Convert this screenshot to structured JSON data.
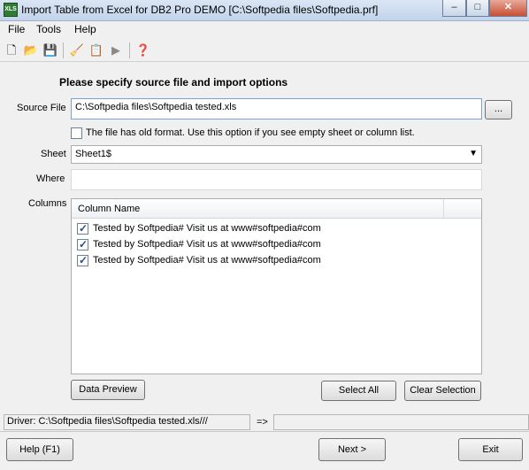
{
  "window": {
    "title": "Import Table from Excel for DB2 Pro DEMO [C:\\Softpedia files\\Softpedia.prf]",
    "app_icon_label": "XLS",
    "minimize": "–",
    "maximize": "□",
    "close": "✕"
  },
  "menu": [
    "File",
    "Tools",
    "Help"
  ],
  "toolbar": {
    "new": "🗋",
    "open": "📂",
    "save": "💾",
    "wizard": "🧹",
    "options": "📋",
    "run": "▶",
    "help": "❓"
  },
  "form": {
    "heading": "Please specify source file and import options",
    "source_file_label": "Source File",
    "source_file_value": "C:\\Softpedia files\\Softpedia tested.xls",
    "browse_label": "...",
    "old_format_label": "The file has old format. Use this option if you see empty sheet or column list.",
    "sheet_label": "Sheet",
    "sheet_value": "Sheet1$",
    "where_label": "Where",
    "where_value": "",
    "columns_label": "Columns"
  },
  "columns": {
    "header": "Column Name",
    "rows": [
      {
        "text": "Tested by Softpedia# Visit us at www#softpedia#com",
        "checked": true
      },
      {
        "text": "Tested by Softpedia# Visit us at www#softpedia#com",
        "checked": true
      },
      {
        "text": "Tested by Softpedia# Visit us at www#softpedia#com",
        "checked": true
      }
    ]
  },
  "buttons": {
    "data_preview": "Data Preview",
    "select_all": "Select All",
    "clear_selection": "Clear Selection",
    "help": "Help (F1)",
    "next": "Next >",
    "exit": "Exit"
  },
  "status": {
    "driver": "Driver: C:\\Softpedia files\\Softpedia tested.xls///",
    "arrow": "=>"
  }
}
